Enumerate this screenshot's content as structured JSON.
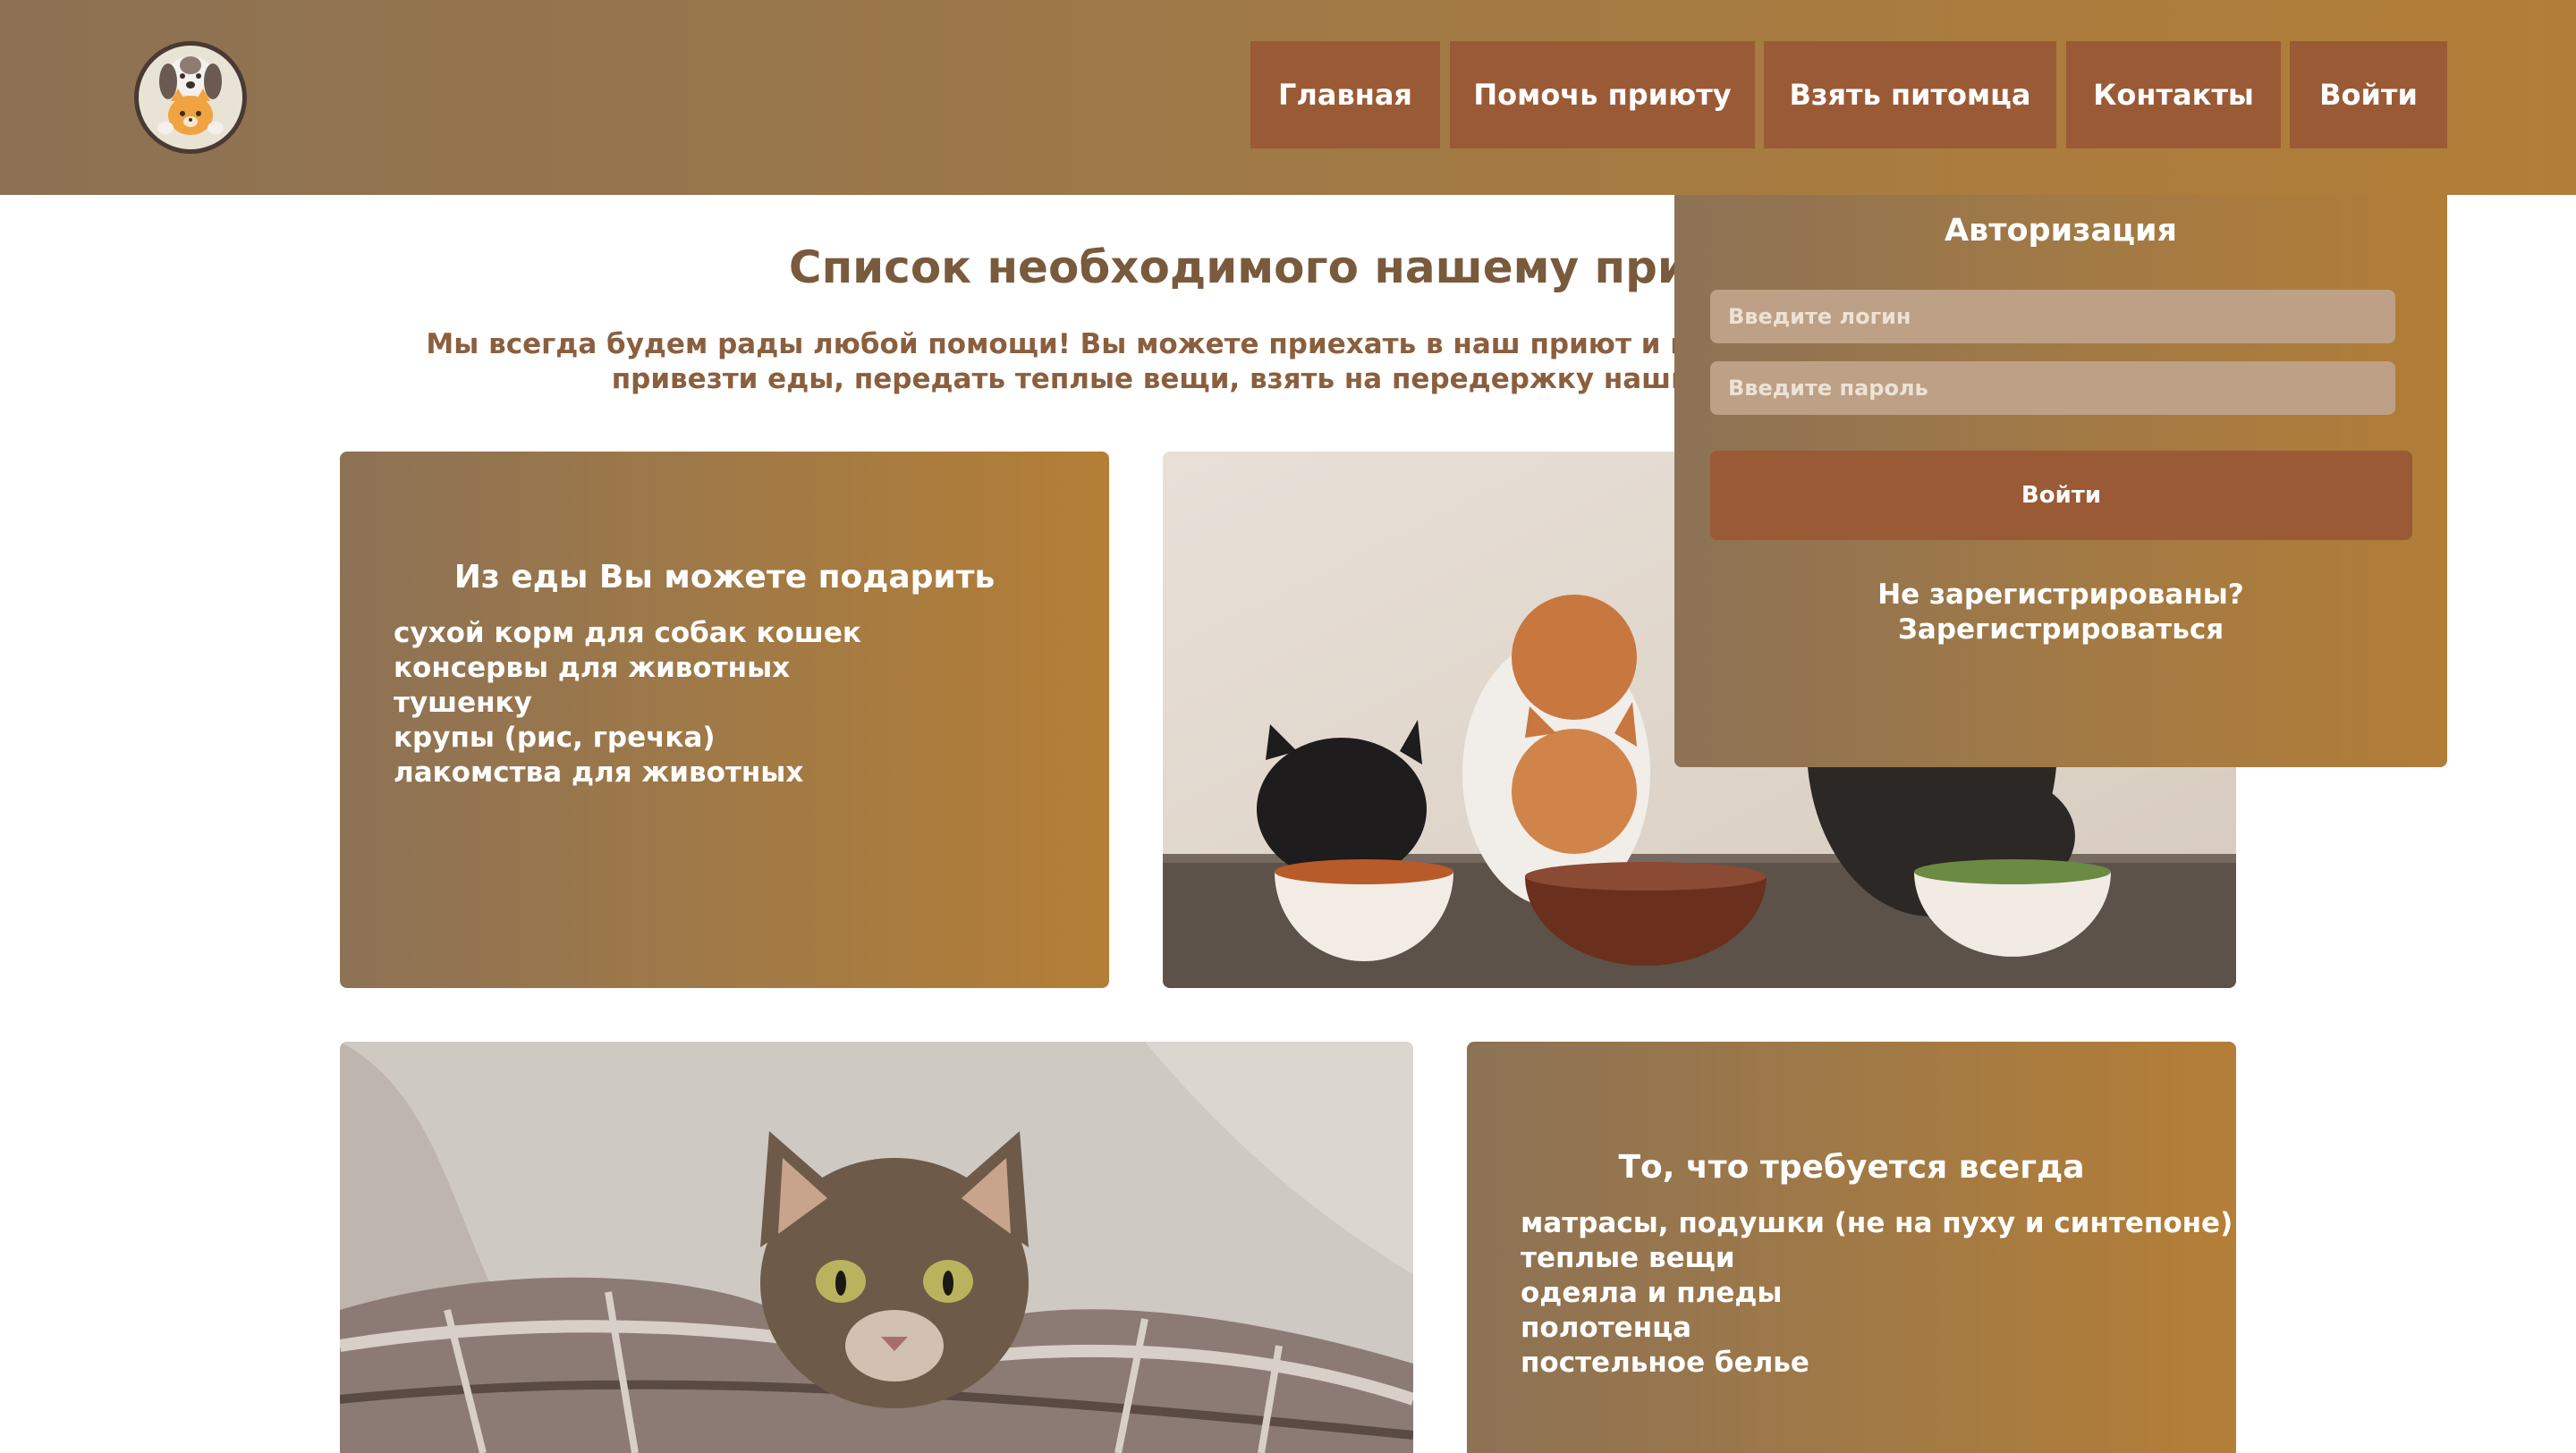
{
  "header": {
    "logo_icon": "dog-and-cat-logo-icon",
    "nav": [
      {
        "label": "Главная"
      },
      {
        "label": "Помочь приюту"
      },
      {
        "label": "Взять питомца"
      },
      {
        "label": "Контакты"
      },
      {
        "label": "Войти"
      }
    ]
  },
  "main": {
    "title": "Список необходимого нашему приюту",
    "intro_line1": "Мы всегда будем рады любой помощи! Вы можете приехать в наш приют и помочь покормить животных,",
    "intro_line2": "привезти еды, передать теплые вещи, взять на передержку наших собак и кошек."
  },
  "cards": {
    "food": {
      "title": "Из еды Вы можете подарить",
      "items": [
        "сухой корм для собак кошек",
        "консервы для животных",
        "тушенку",
        "крупы (рис, гречка)",
        "лакомства для животных"
      ]
    },
    "always": {
      "title": "То, что требуется всегда",
      "items": [
        "матрасы, подушки (не на пуху и синтепоне)",
        "теплые вещи",
        "одеяла и пледы",
        "полотенца",
        "постельное белье"
      ]
    }
  },
  "photos": {
    "cats_eating": "cats-eating-from-bowls-image",
    "cat_blanket": "cat-on-plaid-blanket-image"
  },
  "auth": {
    "title": "Авторизация",
    "login_placeholder": "Введите логин",
    "password_placeholder": "Введите пароль",
    "submit_label": "Войти",
    "not_registered": "Не зарегистрированы?",
    "register_link": "Зарегистрироваться"
  },
  "colors": {
    "header_start": "#8c7153",
    "header_end": "#b27e37",
    "nav_button": "#9b5a36",
    "title_text": "#7a5a3c",
    "intro_text": "#8b5f3e"
  }
}
